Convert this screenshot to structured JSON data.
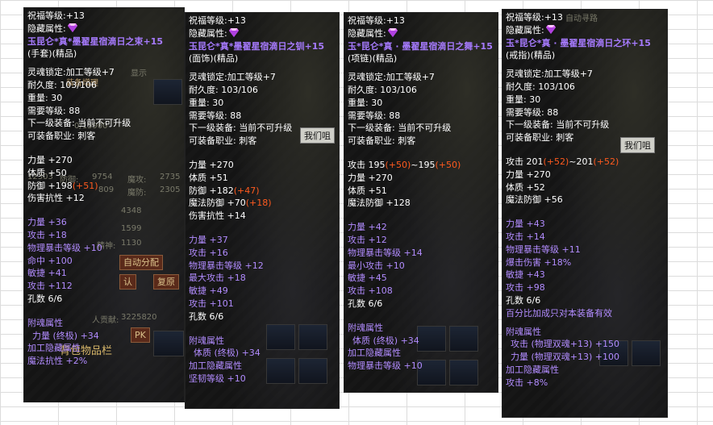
{
  "panels": [
    {
      "lines": [
        {
          "text": "祝福等级:+13",
          "style": "white"
        },
        {
          "text": "隐藏属性:",
          "style": "white",
          "gem": true
        },
        {
          "text": "玉昆仑*真*墨翟星宿滴日之束+15",
          "style": "name"
        },
        {
          "text": "(手套)(精品)",
          "style": "white"
        },
        {
          "text": "",
          "style": "gap2"
        },
        {
          "text": "灵魂锁定:加工等级+7",
          "style": "white"
        },
        {
          "text": "耐久度: 103/106",
          "style": "white"
        },
        {
          "text": "重量: 30",
          "style": "white"
        },
        {
          "text": "需要等级: 88",
          "style": "white"
        },
        {
          "text": "下一级装备: 当前不可升级",
          "style": "white"
        },
        {
          "text": "可装备职业: 刺客",
          "style": "white"
        },
        {
          "text": "",
          "style": "gap"
        },
        {
          "text": "力量 +270",
          "style": "white"
        },
        {
          "text": "体质 +50",
          "style": "white"
        },
        {
          "text": "防御 +198",
          "style": "white",
          "extra": "(+51)"
        },
        {
          "text": "伤害抗性 +12",
          "style": "white"
        },
        {
          "text": "",
          "style": "gap"
        },
        {
          "text": "力量        +36",
          "style": "purple"
        },
        {
          "text": "攻击        +18",
          "style": "purple"
        },
        {
          "text": "物理暴击等级 +10",
          "style": "purple"
        },
        {
          "text": "命中        +100",
          "style": "purple"
        },
        {
          "text": "敏捷        +41",
          "style": "purple"
        },
        {
          "text": "攻击        +112",
          "style": "purple"
        },
        {
          "text": "孔数 6/6",
          "style": "white"
        },
        {
          "text": "",
          "style": "gap"
        },
        {
          "text": "附魂属性",
          "style": "purple"
        },
        {
          "text": "力量 (终极) +34",
          "style": "purple",
          "indent": true
        },
        {
          "text": "加工隐藏属性",
          "style": "purple"
        },
        {
          "text": "魔法抗性 +2%",
          "style": "purple"
        }
      ]
    },
    {
      "lines": [
        {
          "text": "祝福等级:+13",
          "style": "white"
        },
        {
          "text": "隐藏属性:",
          "style": "white",
          "gem": true
        },
        {
          "text": "玉昆仑*真*墨翟星宿滴日之钏+15",
          "style": "name"
        },
        {
          "text": "(面饰)(精品)",
          "style": "white"
        },
        {
          "text": "",
          "style": "gap2"
        },
        {
          "text": "灵魂锁定:加工等级+7",
          "style": "white"
        },
        {
          "text": "耐久度: 103/106",
          "style": "white"
        },
        {
          "text": "重量: 30",
          "style": "white"
        },
        {
          "text": "需要等级: 88",
          "style": "white"
        },
        {
          "text": "下一级装备: 当前不可升级",
          "style": "white"
        },
        {
          "text": "可装备职业: 刺客",
          "style": "white"
        },
        {
          "text": "",
          "style": "gap"
        },
        {
          "text": "力量 +270",
          "style": "white"
        },
        {
          "text": "体质 +51",
          "style": "white"
        },
        {
          "text": "防御 +182",
          "style": "white",
          "extra": "(+47)"
        },
        {
          "text": "魔法防御 +70",
          "style": "white",
          "extra": "(+18)"
        },
        {
          "text": "伤害抗性 +14",
          "style": "white"
        },
        {
          "text": "",
          "style": "gap"
        },
        {
          "text": "力量        +37",
          "style": "purple"
        },
        {
          "text": "攻击        +16",
          "style": "purple"
        },
        {
          "text": "物理暴击等级 +12",
          "style": "purple"
        },
        {
          "text": "最大攻击    +18",
          "style": "purple"
        },
        {
          "text": "敏捷        +49",
          "style": "purple"
        },
        {
          "text": "攻击        +101",
          "style": "purple"
        },
        {
          "text": "孔数 6/6",
          "style": "white"
        },
        {
          "text": "",
          "style": "gap"
        },
        {
          "text": "附魂属性",
          "style": "purple"
        },
        {
          "text": "体质 (终极) +34",
          "style": "purple",
          "indent": true
        },
        {
          "text": "加工隐藏属性",
          "style": "purple"
        },
        {
          "text": "坚韧等级 +10",
          "style": "purple"
        }
      ]
    },
    {
      "lines": [
        {
          "text": "祝福等级:+13",
          "style": "white"
        },
        {
          "text": "隐藏属性:",
          "style": "white",
          "gem": true
        },
        {
          "text": "玉*昆仑*真 · 墨翟星宿滴日之舞+15",
          "style": "name"
        },
        {
          "text": "(项链)(精品)",
          "style": "white"
        },
        {
          "text": "",
          "style": "gap2"
        },
        {
          "text": "灵魂锁定:加工等级+7",
          "style": "white"
        },
        {
          "text": "耐久度: 103/106",
          "style": "white"
        },
        {
          "text": "重量: 30",
          "style": "white"
        },
        {
          "text": "需要等级: 88",
          "style": "white"
        },
        {
          "text": "下一级装备: 当前不可升级",
          "style": "white"
        },
        {
          "text": "可装备职业: 刺客",
          "style": "white"
        },
        {
          "text": "",
          "style": "gap"
        },
        {
          "text": "攻击 195",
          "style": "white",
          "extra": "(+50)",
          "tail": "~195",
          "extra2": "(+50)"
        },
        {
          "text": "力量 +270",
          "style": "white"
        },
        {
          "text": "体质 +51",
          "style": "white"
        },
        {
          "text": "魔法防御 +128",
          "style": "white"
        },
        {
          "text": "",
          "style": "gap"
        },
        {
          "text": "力量        +42",
          "style": "purple"
        },
        {
          "text": "攻击        +12",
          "style": "purple"
        },
        {
          "text": "物理暴击等级 +14",
          "style": "purple"
        },
        {
          "text": "最小攻击    +10",
          "style": "purple"
        },
        {
          "text": "敏捷        +45",
          "style": "purple"
        },
        {
          "text": "攻击        +108",
          "style": "purple"
        },
        {
          "text": "孔数 6/6",
          "style": "white"
        },
        {
          "text": "",
          "style": "gap"
        },
        {
          "text": "附魂属性",
          "style": "purple"
        },
        {
          "text": "体质 (终极) +34",
          "style": "purple",
          "indent": true
        },
        {
          "text": "加工隐藏属性",
          "style": "purple"
        },
        {
          "text": "物理暴击等级 +10",
          "style": "purple"
        }
      ]
    },
    {
      "lines": [
        {
          "text": "祝福等级:+13",
          "style": "white"
        },
        {
          "text": "隐藏属性:",
          "style": "white",
          "gem": true
        },
        {
          "text": "玉*昆仑*真 · 墨翟星宿滴日之环+15",
          "style": "name"
        },
        {
          "text": "(戒指)(精品)",
          "style": "white"
        },
        {
          "text": "",
          "style": "gap2"
        },
        {
          "text": "灵魂锁定:加工等级+7",
          "style": "white"
        },
        {
          "text": "耐久度: 103/106",
          "style": "white"
        },
        {
          "text": "重量: 30",
          "style": "white"
        },
        {
          "text": "需要等级: 88",
          "style": "white"
        },
        {
          "text": "下一级装备: 当前不可升级",
          "style": "white"
        },
        {
          "text": "可装备职业: 刺客",
          "style": "white"
        },
        {
          "text": "",
          "style": "gap"
        },
        {
          "text": "攻击 201",
          "style": "white",
          "extra": "(+52)",
          "tail": "~201",
          "extra2": "(+52)"
        },
        {
          "text": "力量 +270",
          "style": "white"
        },
        {
          "text": "体质 +52",
          "style": "white"
        },
        {
          "text": "魔法防御 +56",
          "style": "white"
        },
        {
          "text": "",
          "style": "gap"
        },
        {
          "text": "力量        +43",
          "style": "purple"
        },
        {
          "text": "攻击        +14",
          "style": "purple"
        },
        {
          "text": "物理暴击等级 +11",
          "style": "purple"
        },
        {
          "text": "爆击伤害    +18%",
          "style": "purple"
        },
        {
          "text": "敏捷        +43",
          "style": "purple"
        },
        {
          "text": "攻击        +98",
          "style": "purple"
        },
        {
          "text": "孔数 6/6",
          "style": "white"
        },
        {
          "text": "百分比加成只对本装备有效",
          "style": "purple"
        },
        {
          "text": "",
          "style": "gap2"
        },
        {
          "text": "附魂属性",
          "style": "purple"
        },
        {
          "text": "攻击 (物理双魂+13) +150",
          "style": "purple",
          "indent": true
        },
        {
          "text": "力量 (物理双魂+13) +100",
          "style": "purple",
          "indent": true
        },
        {
          "text": "加工隐藏属性",
          "style": "purple"
        },
        {
          "text": "攻击        +8%",
          "style": "purple"
        }
      ]
    }
  ],
  "background_fragments": {
    "p1": [
      "装备增理",
      "显示",
      "时",
      "0/15900",
      "12303",
      "防御:",
      "9754",
      "魔攻:",
      "2735",
      "809",
      "魔防:",
      "2305",
      "4348",
      "1599",
      "精神:",
      "1130",
      "自动分配",
      "潜",
      "认",
      "复原",
      "人贡献:",
      "3225820",
      "PK",
      "值",
      "背包物品栏"
    ],
    "p2": [
      "我们咀"
    ],
    "p4": [
      "自动寻路",
      "我们咀"
    ]
  },
  "colors": {
    "purple": "#b28cff",
    "name": "#a77bff",
    "red": "#ff5a1e",
    "white": "#ffffff"
  }
}
